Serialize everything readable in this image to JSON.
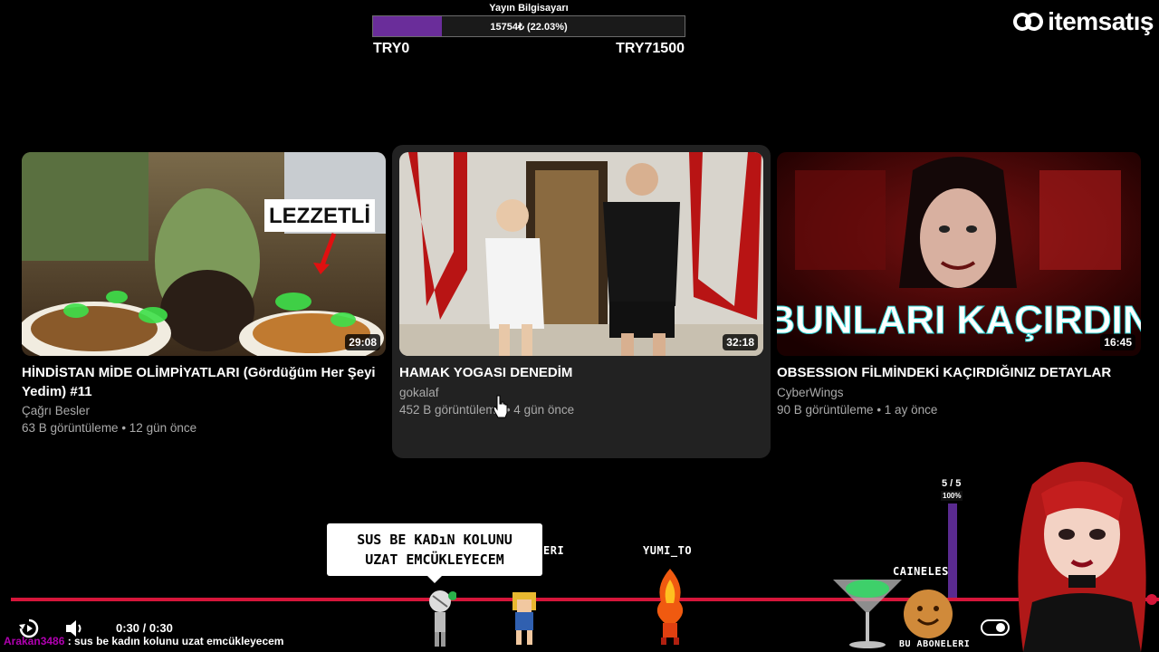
{
  "goal": {
    "title": "Yayın Bilgisayarı",
    "progress_text": "15754₺ (22.03%)",
    "progress_fraction": 0.2203,
    "min_label": "TRY0",
    "max_label": "TRY71500",
    "fill_color": "#6a2d9a"
  },
  "brand": {
    "name": "itemsatış"
  },
  "videos": [
    {
      "title": "HİNDİSTAN MİDE OLİMPİYATLARI (Gördüğüm Her Şeyi Yedim) #11",
      "channel": "Çağrı Besler",
      "meta": "63 B görüntüleme • 12 gün önce",
      "duration": "29:08",
      "thumb_text": "LEZZETLİ"
    },
    {
      "title": "HAMAK YOGASI DENEDİM",
      "channel": "gokalaf",
      "meta": "452 B görüntüleme • 4 gün önce",
      "duration": "32:18",
      "thumb_text": ""
    },
    {
      "title": "OBSESSION FİLMİNDEKİ KAÇIRDIĞINIZ DETAYLAR",
      "channel": "CyberWings",
      "meta": "90 B görüntüleme • 1 ay önce",
      "duration": "16:45",
      "thumb_text": "BUNLARI KAÇIRDIN"
    }
  ],
  "player": {
    "time": "0:30 / 0:30",
    "progress_fraction": 1.0,
    "accent": "#d6163a"
  },
  "chat": {
    "user": "Arakan3486",
    "message": " : sus be kadın kolunu uzat emcükleyecem"
  },
  "overlay": {
    "speech_line1": "SUS BE KADıN KOLUNU",
    "speech_line2": "UZAT EMCÜKLEYECEM",
    "label_partial": "ERI",
    "label_yumi": "YUMI_TO",
    "label_caineless": "CAINELESS",
    "label_bottom": "BU    ABONELERI",
    "vote_count": "5 / 5",
    "vote_pct": "100%"
  }
}
